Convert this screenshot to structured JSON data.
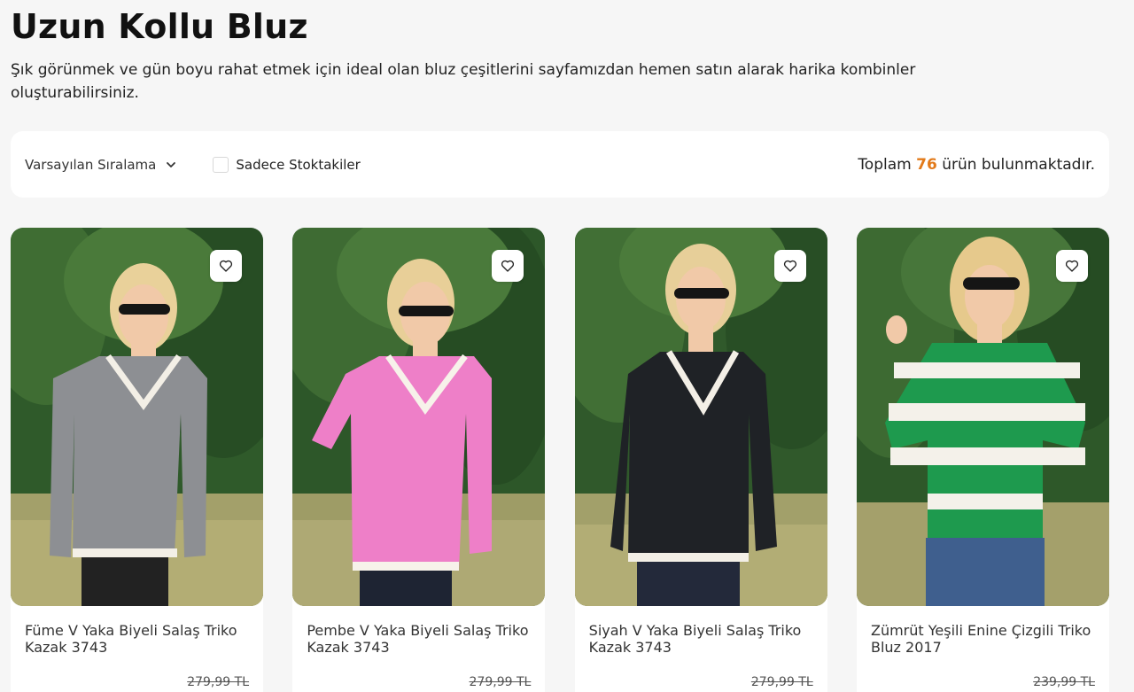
{
  "page": {
    "title": "Uzun Kollu Bluz",
    "description": "Şık görünmek ve gün boyu rahat etmek için ideal olan bluz çeşitlerini sayfamızdan hemen satın alarak harika kombinler oluşturabilirsiniz."
  },
  "toolbar": {
    "sort_label": "Varsayılan Sıralama",
    "sort_icon": "chevron-down-icon",
    "stock_label": "Sadece Stoktakiler",
    "stock_checked": false,
    "total_prefix": "Toplam",
    "total_count": "76",
    "total_suffix": "ürün bulunmaktadır."
  },
  "colors": {
    "accent": "#e27a1a",
    "background": "#f6f6f6",
    "card": "#ffffff"
  },
  "products": [
    {
      "name": "Füme V Yaka Biyeli Salaş Triko Kazak 3743",
      "old_price": "279,99 TL",
      "garment_color": "#8d8f93",
      "fav_icon": "heart-icon"
    },
    {
      "name": "Pembe V Yaka Biyeli Salaş Triko Kazak 3743",
      "old_price": "279,99 TL",
      "garment_color": "#ee7fc8",
      "fav_icon": "heart-icon"
    },
    {
      "name": "Siyah V Yaka Biyeli Salaş Triko Kazak 3743",
      "old_price": "279,99 TL",
      "garment_color": "#1f2226",
      "fav_icon": "heart-icon"
    },
    {
      "name": "Zümrüt Yeşili Enine Çizgili Triko Bluz 2017",
      "old_price": "239,99 TL",
      "garment_color": "#1e9a4e",
      "fav_icon": "heart-icon"
    }
  ]
}
